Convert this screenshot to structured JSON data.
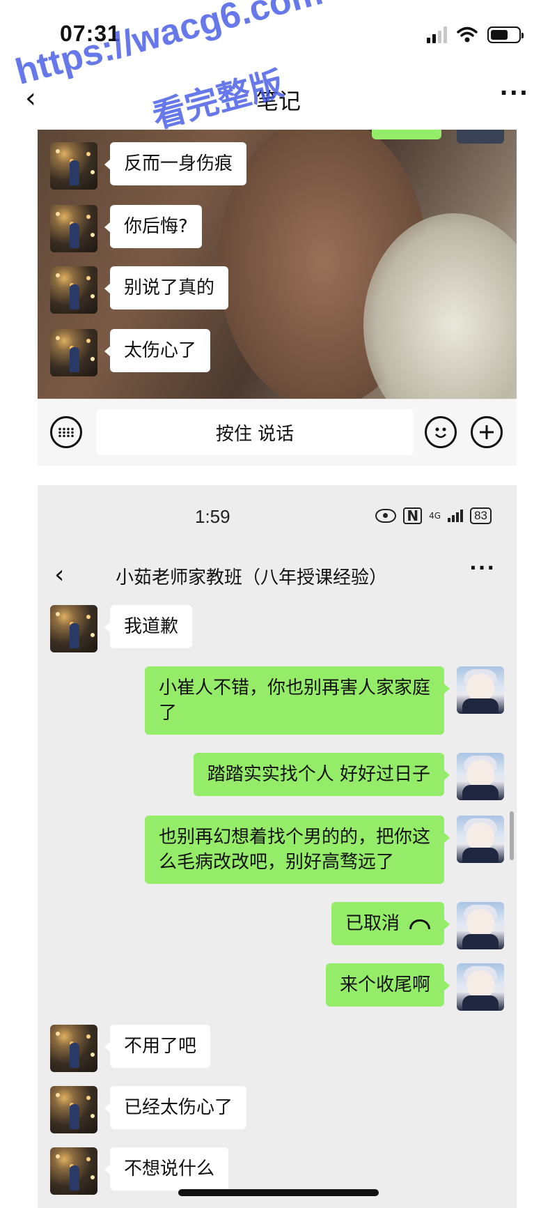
{
  "phone_status": {
    "time": "07:31"
  },
  "outer_nav": {
    "back": "‹",
    "title": "笔记",
    "more": "···"
  },
  "watermark": {
    "url": "https://wacg6.com",
    "text": "看完整版"
  },
  "top_chat": {
    "messages": [
      {
        "side": "in",
        "text": "反而一身伤痕"
      },
      {
        "side": "in",
        "text": "你后悔?"
      },
      {
        "side": "in",
        "text": "别说了真的"
      },
      {
        "side": "in",
        "text": "太伤心了"
      }
    ],
    "input": {
      "talk_label": "按住 说话"
    }
  },
  "second_chat": {
    "status": {
      "time": "1:59",
      "network": "4G",
      "battery": "83"
    },
    "nav": {
      "back": "‹",
      "title": "小茹老师家教班（八年授课经验）",
      "more": "···"
    },
    "messages": [
      {
        "side": "in",
        "text": "我道歉"
      },
      {
        "side": "out",
        "line1": "小崔人不错，你也别再害人家家庭",
        "line2": "了"
      },
      {
        "side": "out",
        "text": "踏踏实实找个人 好好过日子"
      },
      {
        "side": "out",
        "line1": "也别再幻想着找个男的的，把你这",
        "line2": "么毛病改改吧，别好高骛远了"
      },
      {
        "side": "out",
        "text": "已取消"
      },
      {
        "side": "out",
        "text": "来个收尾啊"
      },
      {
        "side": "in",
        "text": "不用了吧"
      },
      {
        "side": "in",
        "text": "已经太伤心了"
      },
      {
        "side": "in",
        "text": "不想说什么"
      }
    ]
  },
  "colors": {
    "sent_bubble": "#95ec69",
    "received_bubble": "#ffffff",
    "chat_bg": "#ededed",
    "watermark": "#465ae6"
  }
}
